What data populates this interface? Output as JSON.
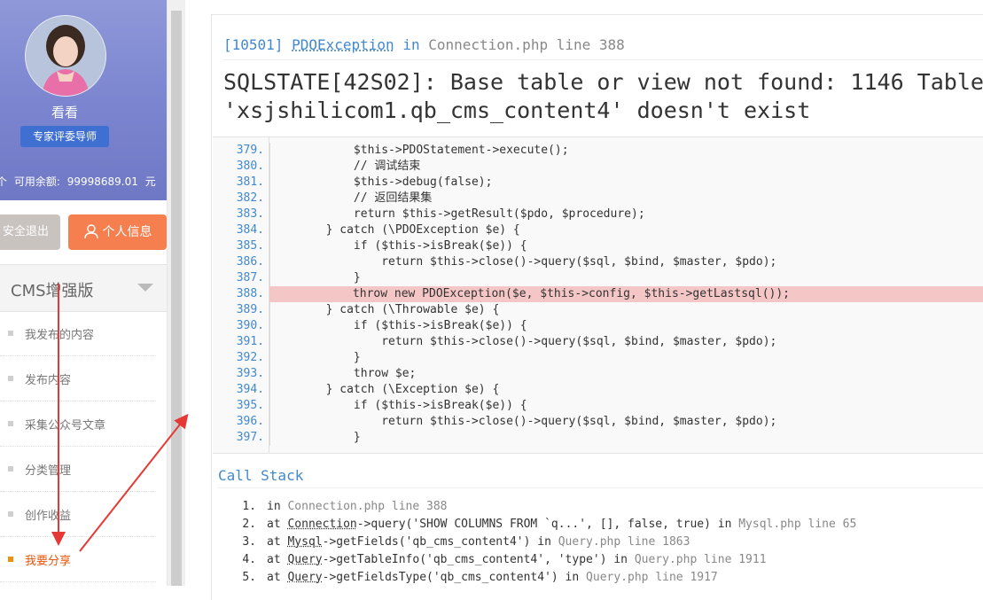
{
  "sidebar": {
    "username": "看看",
    "role": "专家评委导师",
    "balance": {
      "count_suffix": "个",
      "label": "可用余额:",
      "amount": "99998689.01",
      "unit": "元"
    },
    "logout_label": "安全退出",
    "profile_label": "个人信息",
    "menu_title": "CMS增强版",
    "items": [
      {
        "label": "我发布的内容"
      },
      {
        "label": "发布内容"
      },
      {
        "label": "采集公众号文章"
      },
      {
        "label": "分类管理"
      },
      {
        "label": "创作收益"
      },
      {
        "label": "我要分享",
        "active": true
      }
    ],
    "accent": "#f57f4f"
  },
  "error": {
    "code": "[10501]",
    "exception_class": "PDOException",
    "in_word": "in",
    "file": "Connection.php",
    "line_word": "line",
    "line": "388",
    "message_line1": "SQLSTATE[42S02]: Base table or view not found: 1146 Table",
    "message_line2": "'xsjshilicom1.qb_cms_content4' doesn't exist",
    "source": [
      {
        "n": "379.",
        "code": "            $this->PDOStatement->execute();"
      },
      {
        "n": "380.",
        "code": "            // 调试结束"
      },
      {
        "n": "381.",
        "code": "            $this->debug(false);"
      },
      {
        "n": "382.",
        "code": "            // 返回结果集"
      },
      {
        "n": "383.",
        "code": "            return $this->getResult($pdo, $procedure);"
      },
      {
        "n": "384.",
        "code": "        } catch (\\PDOException $e) {"
      },
      {
        "n": "385.",
        "code": "            if ($this->isBreak($e)) {"
      },
      {
        "n": "386.",
        "code": "                return $this->close()->query($sql, $bind, $master, $pdo);"
      },
      {
        "n": "387.",
        "code": "            }"
      },
      {
        "n": "388.",
        "code": "            throw new PDOException($e, $this->config, $this->getLastsql());",
        "highlight": true
      },
      {
        "n": "389.",
        "code": "        } catch (\\Throwable $e) {"
      },
      {
        "n": "390.",
        "code": "            if ($this->isBreak($e)) {"
      },
      {
        "n": "391.",
        "code": "                return $this->close()->query($sql, $bind, $master, $pdo);"
      },
      {
        "n": "392.",
        "code": "            }"
      },
      {
        "n": "393.",
        "code": "            throw $e;"
      },
      {
        "n": "394.",
        "code": "        } catch (\\Exception $e) {"
      },
      {
        "n": "395.",
        "code": "            if ($this->isBreak($e)) {"
      },
      {
        "n": "396.",
        "code": "                return $this->close()->query($sql, $bind, $master, $pdo);"
      },
      {
        "n": "397.",
        "code": "            }"
      }
    ],
    "call_stack_title": "Call Stack",
    "call_stack": [
      {
        "n": "1.",
        "prefix": "in",
        "cls": "",
        "call": "",
        "loc": "Connection.php line 388"
      },
      {
        "n": "2.",
        "prefix": "at",
        "cls": "Connection",
        "call": "->query('SHOW COLUMNS FROM `q...', [], false, true) in",
        "loc": "Mysql.php line 65"
      },
      {
        "n": "3.",
        "prefix": "at",
        "cls": "Mysql",
        "call": "->getFields('qb_cms_content4') in",
        "loc": "Query.php line 1863"
      },
      {
        "n": "4.",
        "prefix": "at",
        "cls": "Query",
        "call": "->getTableInfo('qb_cms_content4', 'type') in",
        "loc": "Query.php line 1911"
      },
      {
        "n": "5.",
        "prefix": "at",
        "cls": "Query",
        "call": "->getFieldsType('qb_cms_content4') in",
        "loc": "Query.php line 1917"
      }
    ],
    "highlight_color": "#f5c6c6",
    "link_color": "#4288ce"
  }
}
